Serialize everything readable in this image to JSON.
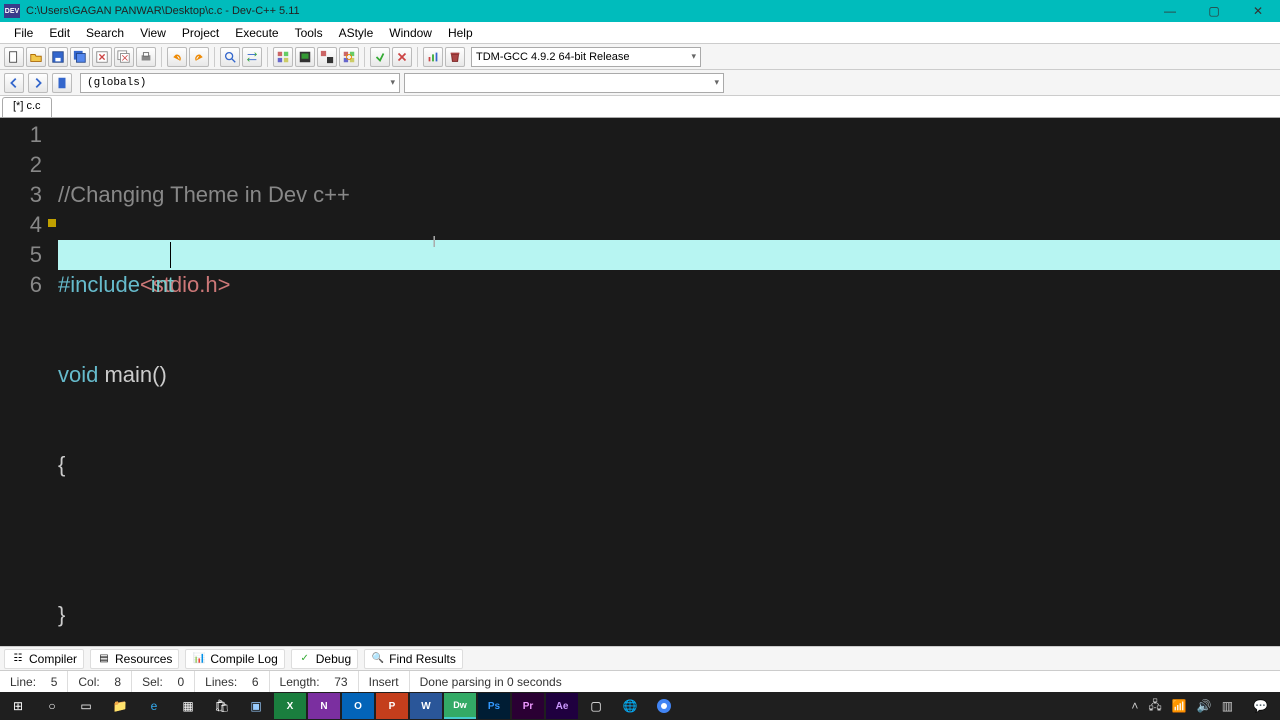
{
  "title": "C:\\Users\\GAGAN PANWAR\\Desktop\\c.c - Dev-C++ 5.11",
  "app_icon_label": "DEV",
  "window_controls": {
    "minimize": "—",
    "maximize": "▢",
    "close": "✕"
  },
  "menu": [
    "File",
    "Edit",
    "Search",
    "View",
    "Project",
    "Execute",
    "Tools",
    "AStyle",
    "Window",
    "Help"
  ],
  "compiler_profile": "TDM-GCC 4.9.2 64-bit Release",
  "class_browser": "(globals)",
  "file_tab": "[*] c.c",
  "code": {
    "line_numbers": [
      "1",
      "2",
      "3",
      "4",
      "5",
      "6"
    ],
    "line1_comment": "//Changing Theme in Dev c++",
    "line2_a": "#include",
    "line2_b": "<stdio.h>",
    "line3_a": "void",
    "line3_b": " main()",
    "line4": "{",
    "line5_text": "int ",
    "line6": "}"
  },
  "bottom_tabs": {
    "compiler": "Compiler",
    "resources": "Resources",
    "compile_log": "Compile Log",
    "debug": "Debug",
    "find_results": "Find Results"
  },
  "status": {
    "line_label": "Line:",
    "line_val": "5",
    "col_label": "Col:",
    "col_val": "8",
    "sel_label": "Sel:",
    "sel_val": "0",
    "lines_label": "Lines:",
    "lines_val": "6",
    "length_label": "Length:",
    "length_val": "73",
    "mode": "Insert",
    "message": "Done parsing in 0 seconds"
  },
  "taskbar": {
    "tray_time": " "
  }
}
